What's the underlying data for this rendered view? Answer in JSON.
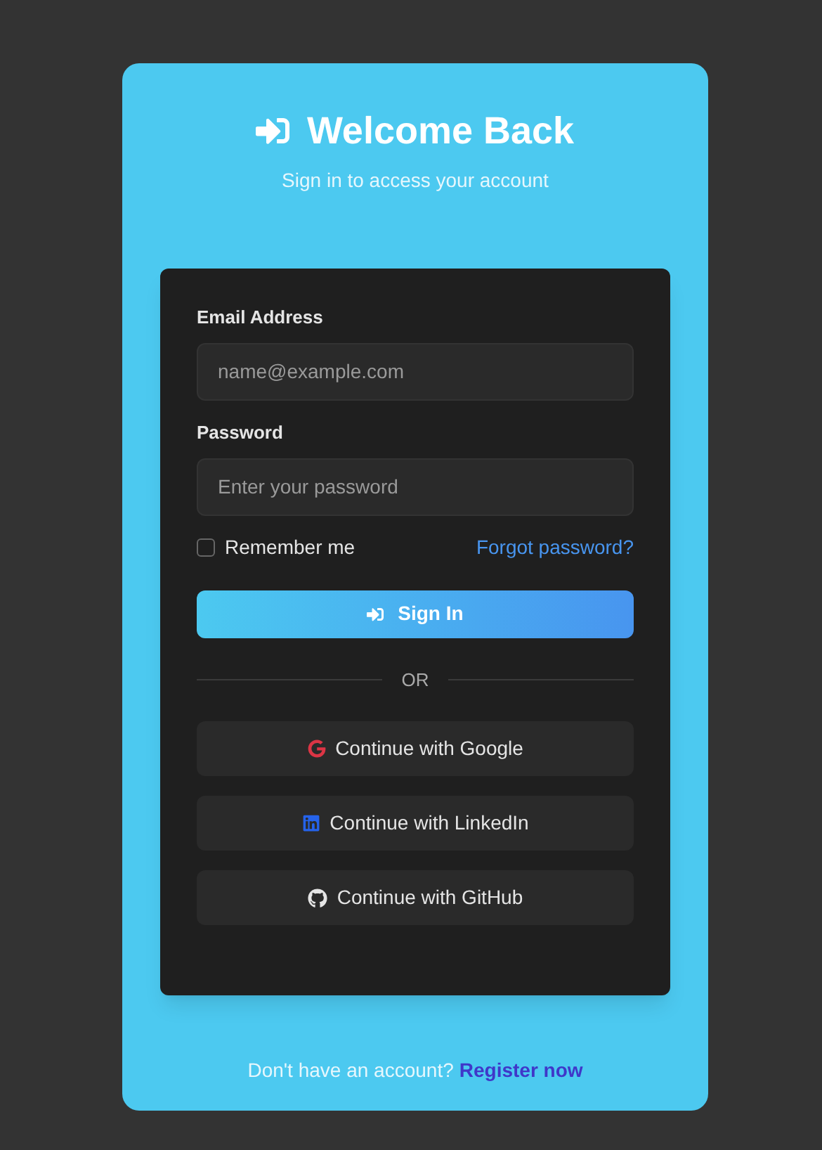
{
  "header": {
    "title": "Welcome Back",
    "subtitle": "Sign in to access your account"
  },
  "form": {
    "email": {
      "label": "Email Address",
      "placeholder": "name@example.com"
    },
    "password": {
      "label": "Password",
      "placeholder": "Enter your password"
    },
    "remember": {
      "label": "Remember me",
      "checked": false
    },
    "forgot_link": "Forgot password?",
    "submit": "Sign In",
    "divider": "OR",
    "social_buttons": [
      {
        "kind": "google",
        "label": "Continue with Google"
      },
      {
        "kind": "linkedin",
        "label": "Continue with LinkedIn"
      },
      {
        "kind": "github",
        "label": "Continue with GitHub"
      }
    ]
  },
  "footer": {
    "text": "Don't have an account?",
    "link": "Register now"
  }
}
